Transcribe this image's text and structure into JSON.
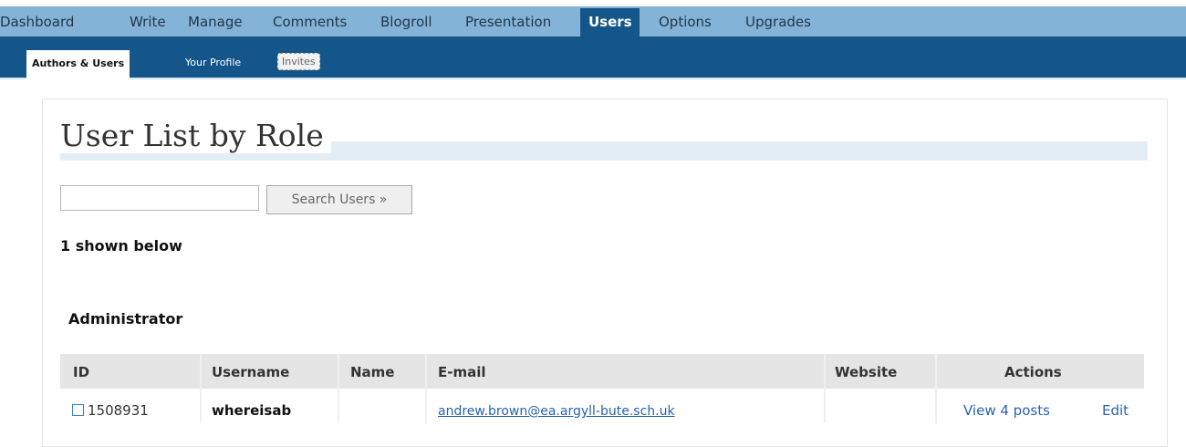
{
  "top_nav": {
    "items": [
      "Dashboard",
      "Write",
      "Manage",
      "Comments",
      "Blogroll",
      "Presentation",
      "Users",
      "Options",
      "Upgrades"
    ],
    "active": "Users"
  },
  "sub_nav": {
    "items": [
      "Authors & Users",
      "Your Profile",
      "Invites"
    ],
    "active": "Authors & Users"
  },
  "page": {
    "title": "User List by Role",
    "search": {
      "value": "",
      "button": "Search Users »"
    },
    "count_text": "1 shown below"
  },
  "role_section": {
    "role": "Administrator",
    "columns": [
      "ID",
      "Username",
      "Name",
      "E-mail",
      "Website",
      "Actions"
    ],
    "rows": [
      {
        "id": "1508931",
        "username": "whereisab",
        "name": "",
        "email": "andrew.brown@ea.argyll-bute.sch.uk",
        "website": "",
        "actions": [
          "View 4 posts",
          "Edit"
        ]
      }
    ]
  }
}
